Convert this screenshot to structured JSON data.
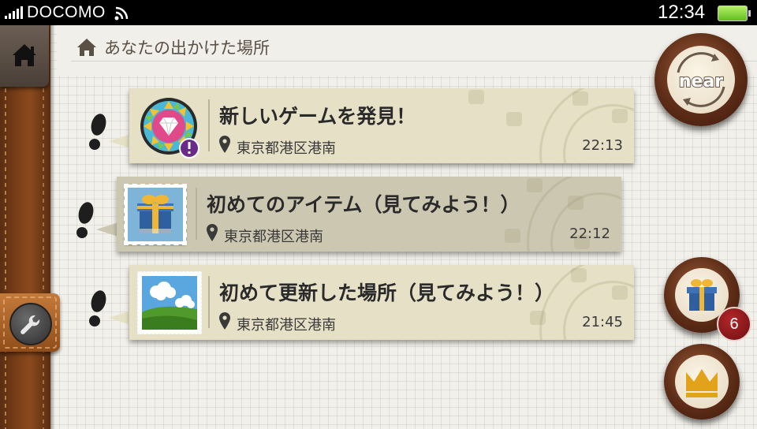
{
  "status_bar": {
    "carrier": "DOCOMO",
    "time": "12:34"
  },
  "page": {
    "title": "あなたの出かけた場所"
  },
  "events": [
    {
      "title": "新しいゲームを発見！",
      "location": "東京都港区港南",
      "time": "22:13",
      "icon": "diamond-badge-icon"
    },
    {
      "title": "初めてのアイテム（見てみよう！）",
      "location": "東京都港区港南",
      "time": "22:12",
      "icon": "gift-stamp-icon"
    },
    {
      "title": "初めて更新した場所（見てみよう！）",
      "location": "東京都港区港南",
      "time": "21:45",
      "icon": "landscape-stamp-icon"
    }
  ],
  "side_buttons": {
    "near_label": "near",
    "gift_count": "6"
  },
  "colors": {
    "card": "#e6e1c6",
    "card_selected": "#cbc7b1",
    "leather": "#7b3f18",
    "badge": "#9b1c20"
  }
}
